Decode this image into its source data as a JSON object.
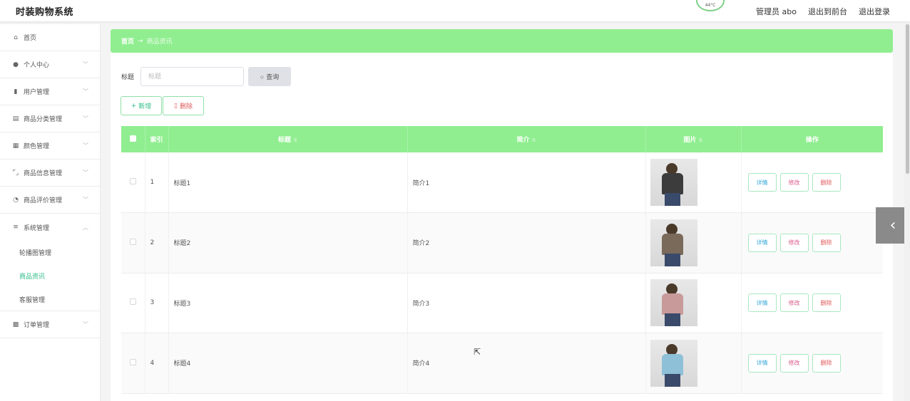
{
  "app": {
    "title": "时装购物系统"
  },
  "weather": {
    "temp": "44°C"
  },
  "topbar": {
    "role": "管理员 abo",
    "front": "退出到前台",
    "logout": "退出登录"
  },
  "sidebar": {
    "items": [
      {
        "label": "首页",
        "icon": "home-icon"
      },
      {
        "label": "个人中心",
        "icon": "user-icon"
      },
      {
        "label": "用户管理",
        "icon": "chart-icon"
      },
      {
        "label": "商品分类管理",
        "icon": "shop-icon"
      },
      {
        "label": "颜色管理",
        "icon": "doc-icon"
      },
      {
        "label": "商品信息管理",
        "icon": "frame-icon"
      },
      {
        "label": "商品评价管理",
        "icon": "clock-icon"
      },
      {
        "label": "系统管理",
        "icon": "list-icon"
      },
      {
        "label": "订单管理",
        "icon": "order-icon"
      }
    ],
    "sub_items": [
      {
        "label": "轮播图管理"
      },
      {
        "label": "商品资讯"
      },
      {
        "label": "客服管理"
      }
    ]
  },
  "breadcrumb": {
    "home": "首页",
    "sep": "→",
    "current": "商品资讯"
  },
  "search": {
    "label": "标题",
    "placeholder": "标题",
    "button": "查询"
  },
  "actions": {
    "add": "新增",
    "delete": "删除"
  },
  "table": {
    "headers": {
      "index": "索引",
      "title": "标题",
      "intro": "简介",
      "image": "图片",
      "ops": "操作"
    },
    "rows": [
      {
        "index": "1",
        "title": "标题1",
        "intro": "简介1",
        "image_color": "#3c3c3c"
      },
      {
        "index": "2",
        "title": "标题2",
        "intro": "简介2",
        "image_color": "#7a6a5a"
      },
      {
        "index": "3",
        "title": "标题3",
        "intro": "简介3",
        "image_color": "#c89a9a"
      },
      {
        "index": "4",
        "title": "标题4",
        "intro": "简介4",
        "image_color": "#8ec0d8"
      }
    ],
    "ops": {
      "detail": "详情",
      "edit": "修改",
      "del": "删除"
    }
  },
  "colors": {
    "accent": "#90ee90",
    "active": "#2ebd88"
  }
}
